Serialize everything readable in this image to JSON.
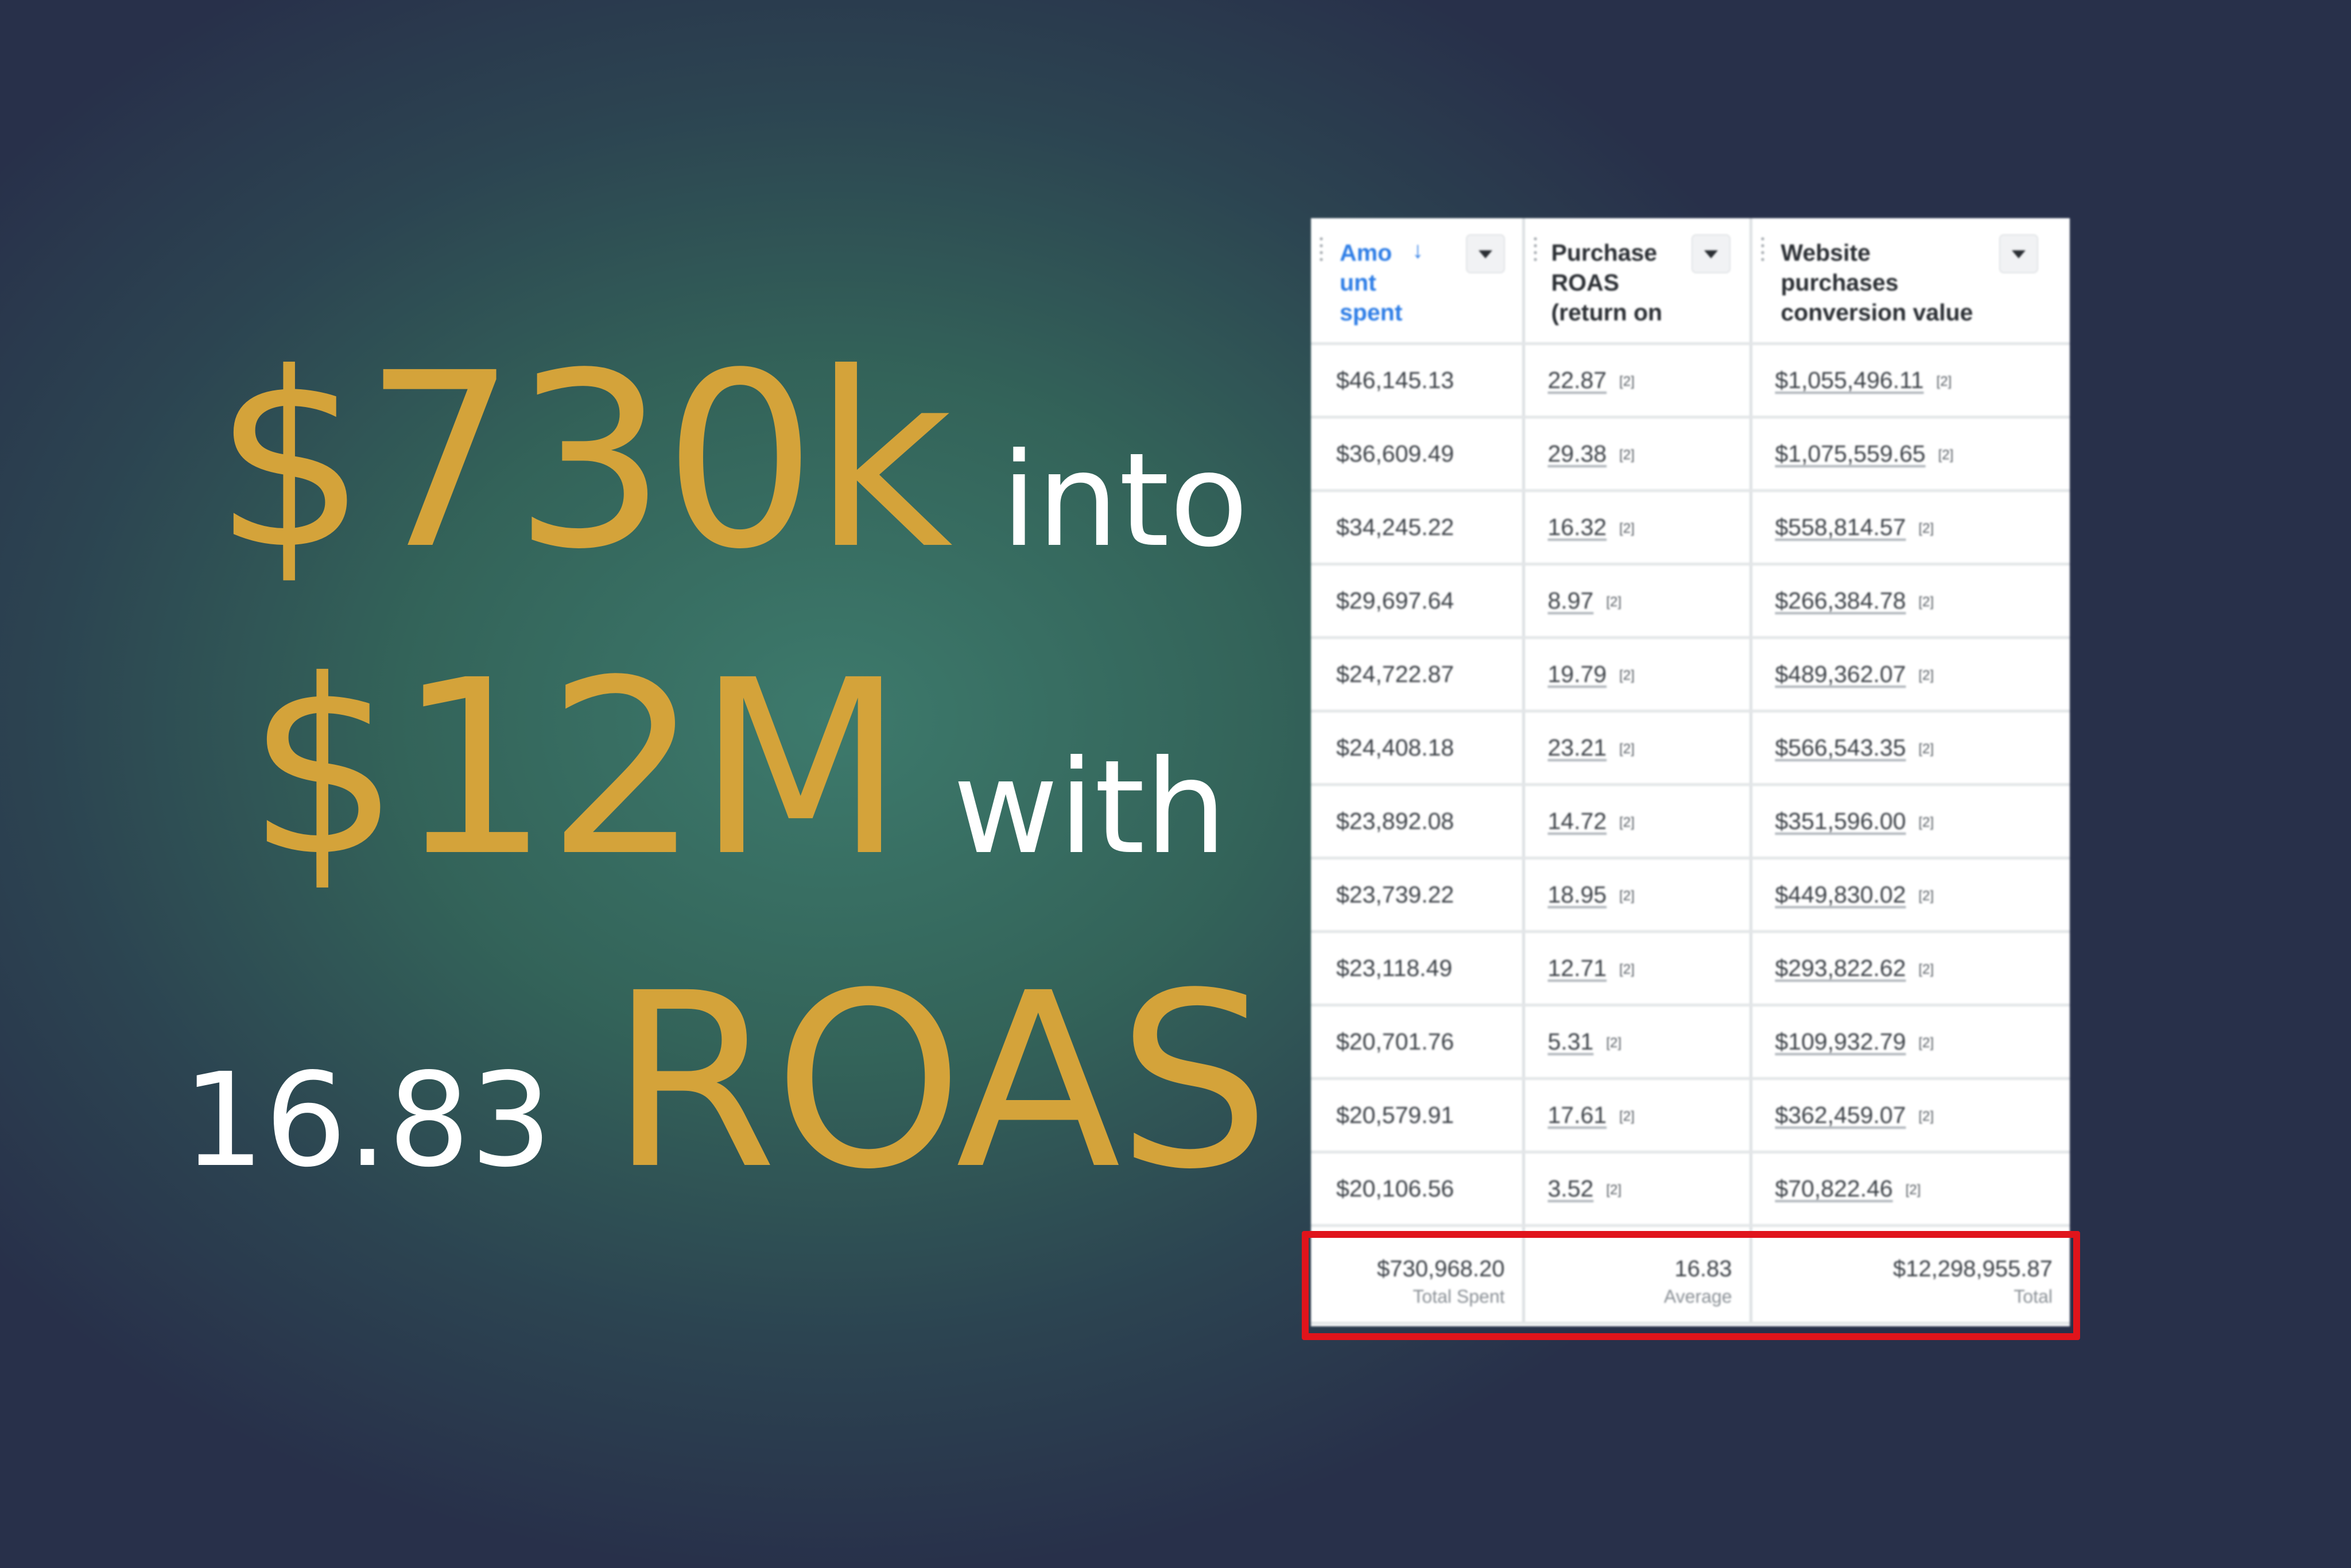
{
  "headline": {
    "line1_big": "$730k",
    "line1_small": "into",
    "line2_big": "$12M",
    "line2_small": "with",
    "line3_small": "16.83",
    "line3_big": "ROAS"
  },
  "table": {
    "columns": [
      {
        "label": "Amo unt spent",
        "sorted": true,
        "sort_icon": "arrow-down-icon"
      },
      {
        "label": "Purchase ROAS (return on"
      },
      {
        "label": "Website purchases conversion value"
      }
    ],
    "rows": [
      {
        "spent": "$46,145.13",
        "roas": "22.87",
        "value": "$1,055,496.11"
      },
      {
        "spent": "$36,609.49",
        "roas": "29.38",
        "value": "$1,075,559.65"
      },
      {
        "spent": "$34,245.22",
        "roas": "16.32",
        "value": "$558,814.57"
      },
      {
        "spent": "$29,697.64",
        "roas": "8.97",
        "value": "$266,384.78"
      },
      {
        "spent": "$24,722.87",
        "roas": "19.79",
        "value": "$489,362.07"
      },
      {
        "spent": "$24,408.18",
        "roas": "23.21",
        "value": "$566,543.35"
      },
      {
        "spent": "$23,892.08",
        "roas": "14.72",
        "value": "$351,596.00"
      },
      {
        "spent": "$23,739.22",
        "roas": "18.95",
        "value": "$449,830.02"
      },
      {
        "spent": "$23,118.49",
        "roas": "12.71",
        "value": "$293,822.62"
      },
      {
        "spent": "$20,701.76",
        "roas": "5.31",
        "value": "$109,932.79"
      },
      {
        "spent": "$20,579.91",
        "roas": "17.61",
        "value": "$362,459.07"
      },
      {
        "spent": "$20,106.56",
        "roas": "3.52",
        "value": "$70,822.46"
      }
    ],
    "badge": "[2]",
    "totals": {
      "spent": "$730,968.20",
      "spent_label": "Total Spent",
      "roas": "16.83",
      "roas_label": "Average",
      "value": "$12,298,955.87",
      "value_label": "Total"
    }
  },
  "colors": {
    "gold": "#d4a33a",
    "link_blue": "#2d7de6",
    "highlight_red": "#e0141b",
    "bg_teal": "#3d7a6c",
    "bg_navy": "#28304a"
  }
}
